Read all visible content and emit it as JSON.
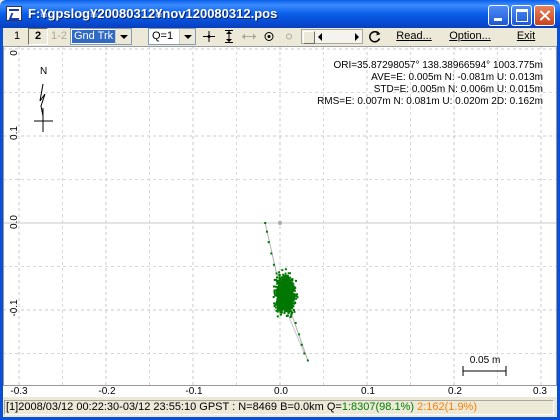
{
  "window": {
    "title": "F:¥gpslog¥20080312¥nov120080312.pos"
  },
  "toolbar": {
    "btn1": "1",
    "btn2": "2",
    "btn12": "1-2",
    "plot_type": "Gnd Trk",
    "quality": "Q=1",
    "read_label": "Read...",
    "option_label": "Option...",
    "exit_label": "Exit"
  },
  "plot": {
    "north_label": "N",
    "info_lines": [
      "ORI=35.87298057° 138.38966594° 1003.775m",
      "AVE=E: 0.005m N: -0.081m U: 0.013m",
      "STD=E: 0.005m N: 0.006m U: 0.015m",
      "RMS=E: 0.007m N: 0.081m U: 0.020m 2D: 0.162m"
    ],
    "scale_label": "0.05 m",
    "y_ticks": [
      "0",
      "0.1",
      "0.0",
      "-0.1"
    ],
    "x_ticks": [
      "-0.3",
      "-0.2",
      "-0.1",
      "0.0",
      "0.1",
      "0.2",
      "0.3"
    ]
  },
  "chart_data": {
    "type": "scatter",
    "xlim": [
      -0.3,
      0.3
    ],
    "ylim": [
      -0.17,
      0.18
    ],
    "grid": true,
    "cluster_center": [
      0.005,
      -0.081
    ],
    "cluster_spread": [
      0.009,
      0.018
    ],
    "track_points": [
      [
        -0.017,
        0.0
      ],
      [
        -0.015,
        -0.01
      ],
      [
        -0.013,
        -0.022
      ],
      [
        -0.01,
        -0.035
      ],
      [
        -0.007,
        -0.048
      ],
      [
        -0.004,
        -0.058
      ],
      [
        0.01,
        -0.095
      ],
      [
        0.013,
        -0.105
      ],
      [
        0.018,
        -0.115
      ],
      [
        0.022,
        -0.128
      ],
      [
        0.025,
        -0.14
      ],
      [
        0.028,
        -0.15
      ],
      [
        0.032,
        -0.158
      ]
    ],
    "point_color": "#007700"
  },
  "status": {
    "prefix": "[1]2008/03/12 00:22:30-03/12 23:55:10 GPST : N=8469 B=0.0km Q=",
    "q1": "1:8307(98.1%)",
    "q2": "2:162(1.9%)"
  }
}
